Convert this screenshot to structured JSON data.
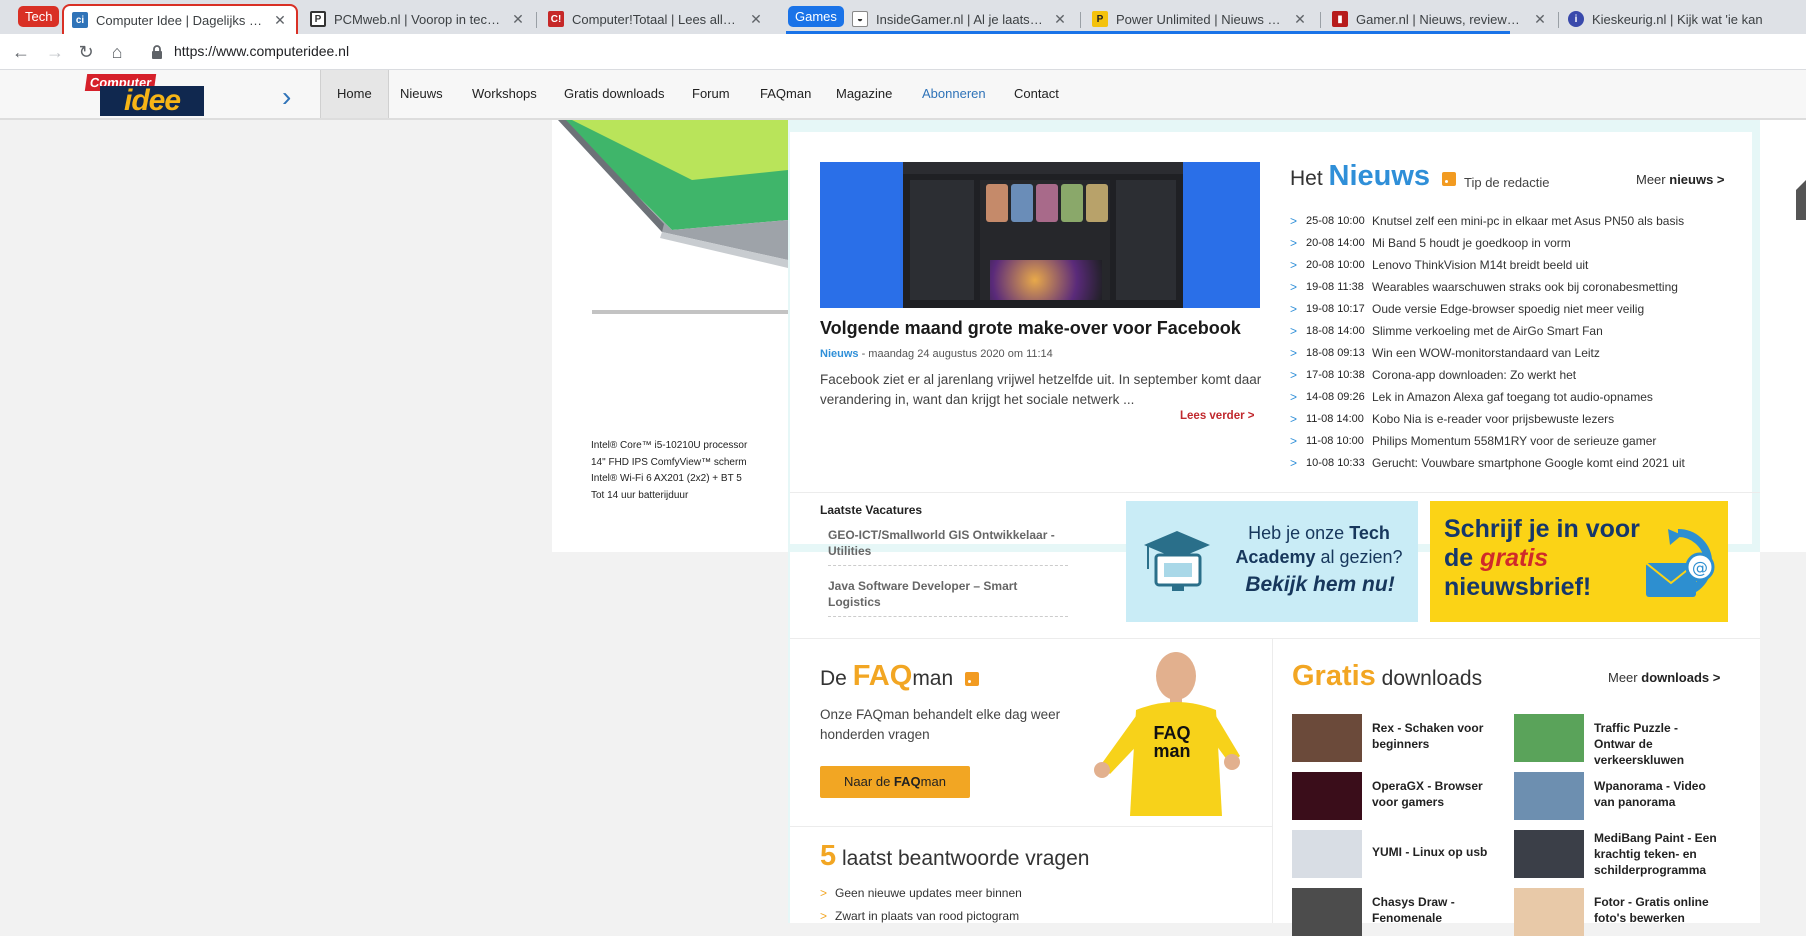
{
  "tab_groups": [
    {
      "label": "Tech",
      "color": "#d93025"
    },
    {
      "label": "Games",
      "color": "#1a73e8"
    }
  ],
  "tabs": [
    {
      "title": "Computer Idee | Dagelijks computer",
      "active": true
    },
    {
      "title": "PCMweb.nl | Voorop in tech, het",
      "active": false
    },
    {
      "title": "Computer!Totaal | Lees alles op C",
      "active": false
    },
    {
      "title": "InsideGamer.nl | Al je laatste gam",
      "active": false
    },
    {
      "title": "Power Unlimited | Nieuws + ente",
      "active": false
    },
    {
      "title": "Gamer.nl | Nieuws, reviews, previ",
      "active": false
    },
    {
      "title": "Kieskeurig.nl | Kijk wat 'ie kan",
      "active": false
    }
  ],
  "toolbar": {
    "url": "https://www.computeridee.nl"
  },
  "logo": {
    "top": "Computer",
    "main": "idee"
  },
  "nav": {
    "items": [
      "Home",
      "Nieuws",
      "Workshops",
      "Gratis downloads",
      "Forum",
      "FAQman",
      "Magazine",
      "Abonneren",
      "Contact"
    ]
  },
  "ad": {
    "specs": [
      "Intel® Core™ i5-10210U processor",
      "14\" FHD IPS ComfyView™ scherm",
      "Intel® Wi-Fi 6 AX201 (2x2) + BT 5",
      "Tot 14 uur batterijduur"
    ]
  },
  "featured": {
    "title": "Volgende maand grote make-over voor Facebook",
    "category": "Nieuws",
    "date": " - maandag 24 augustus 2020 om 11:14",
    "description": "Facebook ziet er al jarenlang vrijwel hetzelfde uit. In september komt daar verandering in, want dan krijgt het sociale netwerk ...",
    "read_more": "Lees verder >"
  },
  "news": {
    "prefix": "Het",
    "big": "Nieuws",
    "tip": "Tip de redactie",
    "more_prefix": "Meer",
    "more_bold": "nieuws >",
    "items": [
      {
        "date": "25-08 10:00",
        "title": "Knutsel zelf een mini-pc in elkaar met Asus PN50 als basis"
      },
      {
        "date": "20-08 14:00",
        "title": "Mi Band 5 houdt je goedkoop in vorm"
      },
      {
        "date": "20-08 10:00",
        "title": "Lenovo ThinkVision M14t breidt beeld uit"
      },
      {
        "date": "19-08 11:38",
        "title": "Wearables waarschuwen straks ook bij coronabesmetting"
      },
      {
        "date": "19-08 10:17",
        "title": "Oude versie Edge-browser spoedig niet meer veilig"
      },
      {
        "date": "18-08 14:00",
        "title": "Slimme verkoeling met de AirGo Smart Fan"
      },
      {
        "date": "18-08 09:13",
        "title": "Win een WOW-monitorstandaard van Leitz"
      },
      {
        "date": "17-08 10:38",
        "title": "Corona-app downloaden: Zo werkt het"
      },
      {
        "date": "14-08 09:26",
        "title": "Lek in Amazon Alexa gaf toegang tot audio-opnames"
      },
      {
        "date": "11-08 14:00",
        "title": "Kobo Nia is e-reader voor prijsbewuste lezers"
      },
      {
        "date": "11-08 10:00",
        "title": "Philips Momentum 558M1RY voor de serieuze gamer"
      },
      {
        "date": "10-08 10:33",
        "title": "Gerucht: Vouwbare smartphone Google komt eind 2021 uit"
      }
    ]
  },
  "vacatures": {
    "title": "Laatste Vacatures",
    "items": [
      "GEO-ICT/Smallworld GIS Ontwikkelaar - Utilities",
      "Java Software Developer – Smart Logistics"
    ]
  },
  "promo_academy": {
    "line1_a": "Heb je onze ",
    "line1_b": "Tech",
    "line2_a": "Academy",
    "line2_b": " al gezien?",
    "cta": "Bekijk hem nu!"
  },
  "promo_newsletter": {
    "a": "Schrijf je in voor de ",
    "red": "gratis",
    "b": " nieuwsbrief!"
  },
  "faq": {
    "prefix": "De ",
    "big": "FAQ",
    "suffix": "man",
    "description": "Onze FAQman behandelt elke dag weer honderden vragen",
    "button_a": "Naar de ",
    "button_b": "FAQ",
    "button_c": "man",
    "shirt": "FAQ man"
  },
  "latest": {
    "num": "5",
    "title": " laatst beantwoorde vragen",
    "items": [
      "Geen nieuwe updates meer binnen",
      "Zwart in plaats van rood pictogram"
    ]
  },
  "downloads": {
    "big": "Gratis",
    "rest": " downloads",
    "more_prefix": "Meer",
    "more_bold": "downloads >",
    "items": [
      {
        "name": "Rex - Schaken voor beginners",
        "color": "#6b4a3a"
      },
      {
        "name": "Traffic Puzzle - Ontwar de verkeerskluwen",
        "color": "#5aa35a"
      },
      {
        "name": "OperaGX - Browser voor gamers",
        "color": "#3a0d1a"
      },
      {
        "name": "Wpanorama - Video van panorama",
        "color": "#6d8fb0"
      },
      {
        "name": "YUMI - Linux op usb",
        "color": "#d8dde4"
      },
      {
        "name": "MediBang Paint - Een krachtig teken- en schilderprogramma",
        "color": "#3b3f48"
      },
      {
        "name": "Chasys Draw - Fenomenale",
        "color": "#4c4c4c"
      },
      {
        "name": "Fotor - Gratis online foto's bewerken",
        "color": "#e8c9a8"
      }
    ]
  }
}
